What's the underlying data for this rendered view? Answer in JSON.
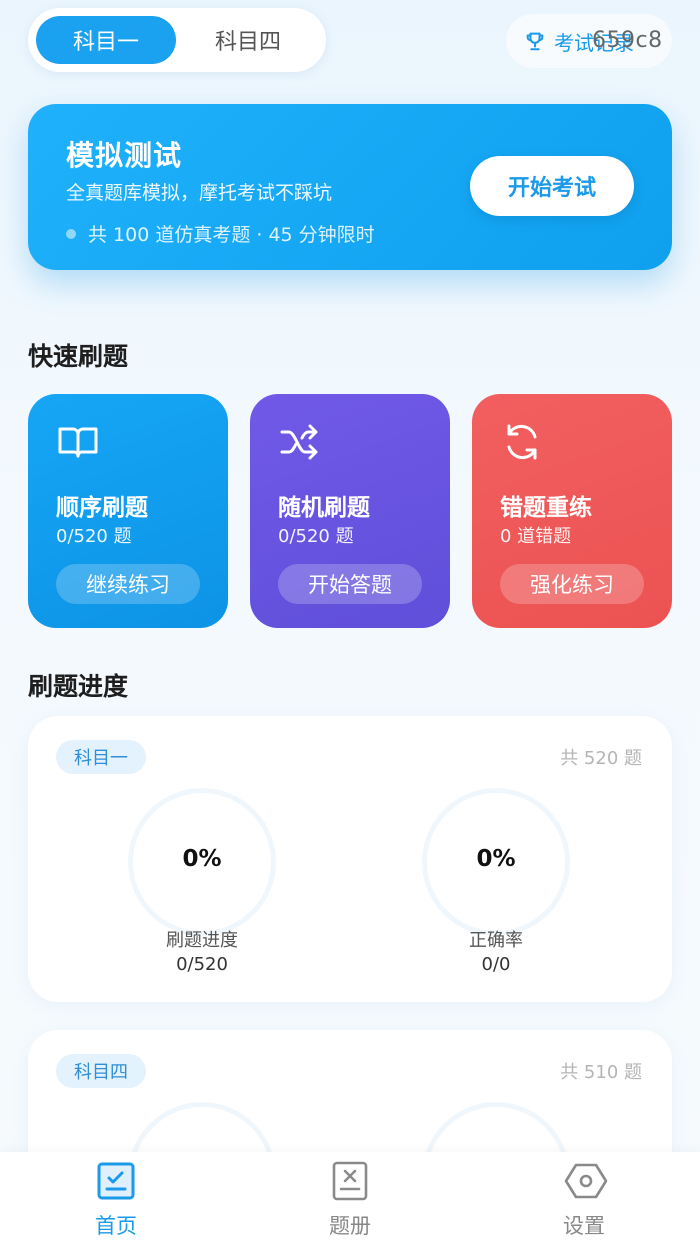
{
  "header": {
    "tabs": [
      {
        "label": "科目一",
        "active": true
      },
      {
        "label": "科目四",
        "active": false
      }
    ],
    "record_label": "考试记录",
    "record_overlay": "659c8"
  },
  "hero": {
    "title": "模拟测试",
    "subtitle": "全真题库模拟，摩托考试不踩坑",
    "meta": "共 100 道仿真考题 · 45 分钟限时",
    "start_label": "开始考试"
  },
  "quick": {
    "section_title": "快速刷题",
    "cards": [
      {
        "icon": "book-icon",
        "title": "顺序刷题",
        "count": "0/520 题",
        "button": "继续练习",
        "color": "#16a6f5"
      },
      {
        "icon": "shuffle-icon",
        "title": "随机刷题",
        "count": "0/520 题",
        "button": "开始答题",
        "color": "#6a55e4"
      },
      {
        "icon": "refresh-icon",
        "title": "错题重练",
        "count": "0 道错题",
        "button": "强化练习",
        "color": "#ef5858"
      }
    ]
  },
  "progress": {
    "section_title": "刷题进度",
    "cards": [
      {
        "badge": "科目一",
        "total": "共 520 题",
        "stats": [
          {
            "pct": "0%",
            "label": "刷题进度",
            "value": "0/520"
          },
          {
            "pct": "0%",
            "label": "正确率",
            "value": "0/0"
          }
        ]
      },
      {
        "badge": "科目四",
        "total": "共 510 题"
      }
    ]
  },
  "nav": {
    "items": [
      {
        "label": "首页",
        "icon": "home-clipboard-icon",
        "active": true
      },
      {
        "label": "题册",
        "icon": "question-book-icon",
        "active": false
      },
      {
        "label": "设置",
        "icon": "settings-icon",
        "active": false
      }
    ]
  },
  "colors": {
    "primary": "#1aa1f0",
    "purple": "#6a55e4",
    "red": "#ef5858"
  }
}
